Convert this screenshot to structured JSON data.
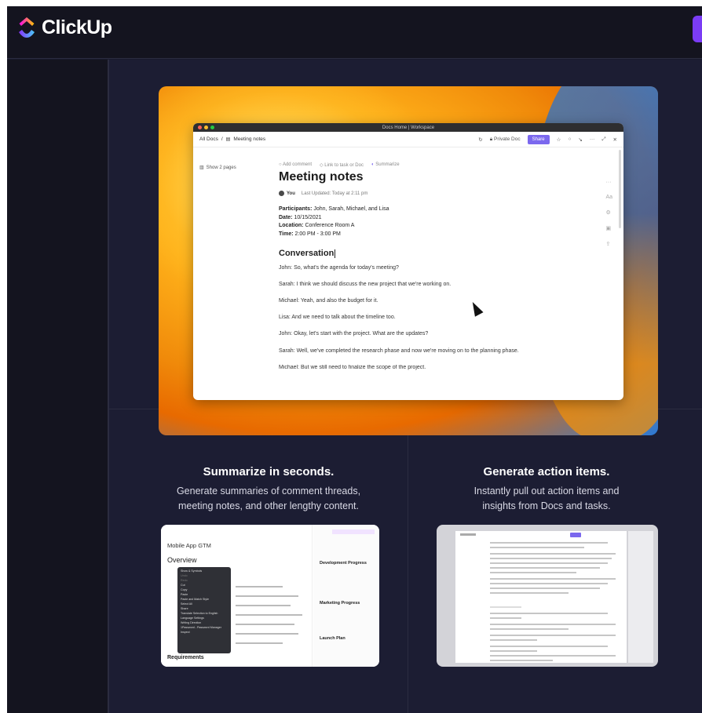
{
  "brand": {
    "name": "ClickUp"
  },
  "hero": {
    "window_title": "Docs Home | Workspace",
    "breadcrumb_root": "All Docs",
    "breadcrumb_sep": "/",
    "breadcrumb_current": "Meeting notes",
    "private_doc": "Private Doc",
    "share": "Share",
    "show_pages": "Show 2 pages",
    "actions": [
      "Add comment",
      "Link to task or Doc",
      "Summarize"
    ],
    "doc_title": "Meeting notes",
    "author": "You",
    "last_updated": "Last Updated:  Today at 2:11 pm",
    "details": {
      "participants_label": "Participants:",
      "participants": " John, Sarah, Michael, and Lisa",
      "date_label": "Date:",
      "date": " 10/15/2021",
      "location_label": "Location:",
      "location": " Conference Room A",
      "time_label": "Time:",
      "time": " 2:00 PM - 3:00 PM"
    },
    "section_heading": "Conversation",
    "conversation": [
      "John: So, what's the agenda for today's meeting?",
      "Sarah: I think we should discuss the new project that we're working on.",
      "Michael: Yeah, and also the budget for it.",
      "Lisa: And we need to talk about the timeline too.",
      "John: Okay, let's start with the project. What are the updates?",
      "Sarah: Well, we've completed the research phase and now we're moving on to the planning phase.",
      "Michael: But we still need to finalize the scope of the project."
    ]
  },
  "features": [
    {
      "title": "Summarize in seconds.",
      "description_line1": "Generate summaries of comment threads,",
      "description_line2": "meeting notes, and other lengthy content."
    },
    {
      "title": "Generate action items.",
      "description_line1": "Instantly pull out action items and",
      "description_line2": "insights from Docs and tasks."
    }
  ],
  "thumb_left": {
    "doc_name": "Mobile App GTM",
    "heading": "Overview",
    "sub_heading": "Requirements",
    "side_headings": [
      "Development Progress",
      "Marketing Progress",
      "Launch Plan"
    ],
    "menu_items": [
      "Show & Symbols",
      "Undo",
      "Redo",
      "Cut",
      "Copy",
      "Paste",
      "Paste and Match Style",
      "Select All",
      "Share",
      "Translate Selection to English",
      "Language Settings",
      "Writing Direction",
      "1Password - Password Manager",
      "Inspect"
    ]
  },
  "colors": {
    "frame_bg": "#1a1b2d",
    "brand_purple": "#7b68ee",
    "cta_purple": "#7b3cf5"
  }
}
